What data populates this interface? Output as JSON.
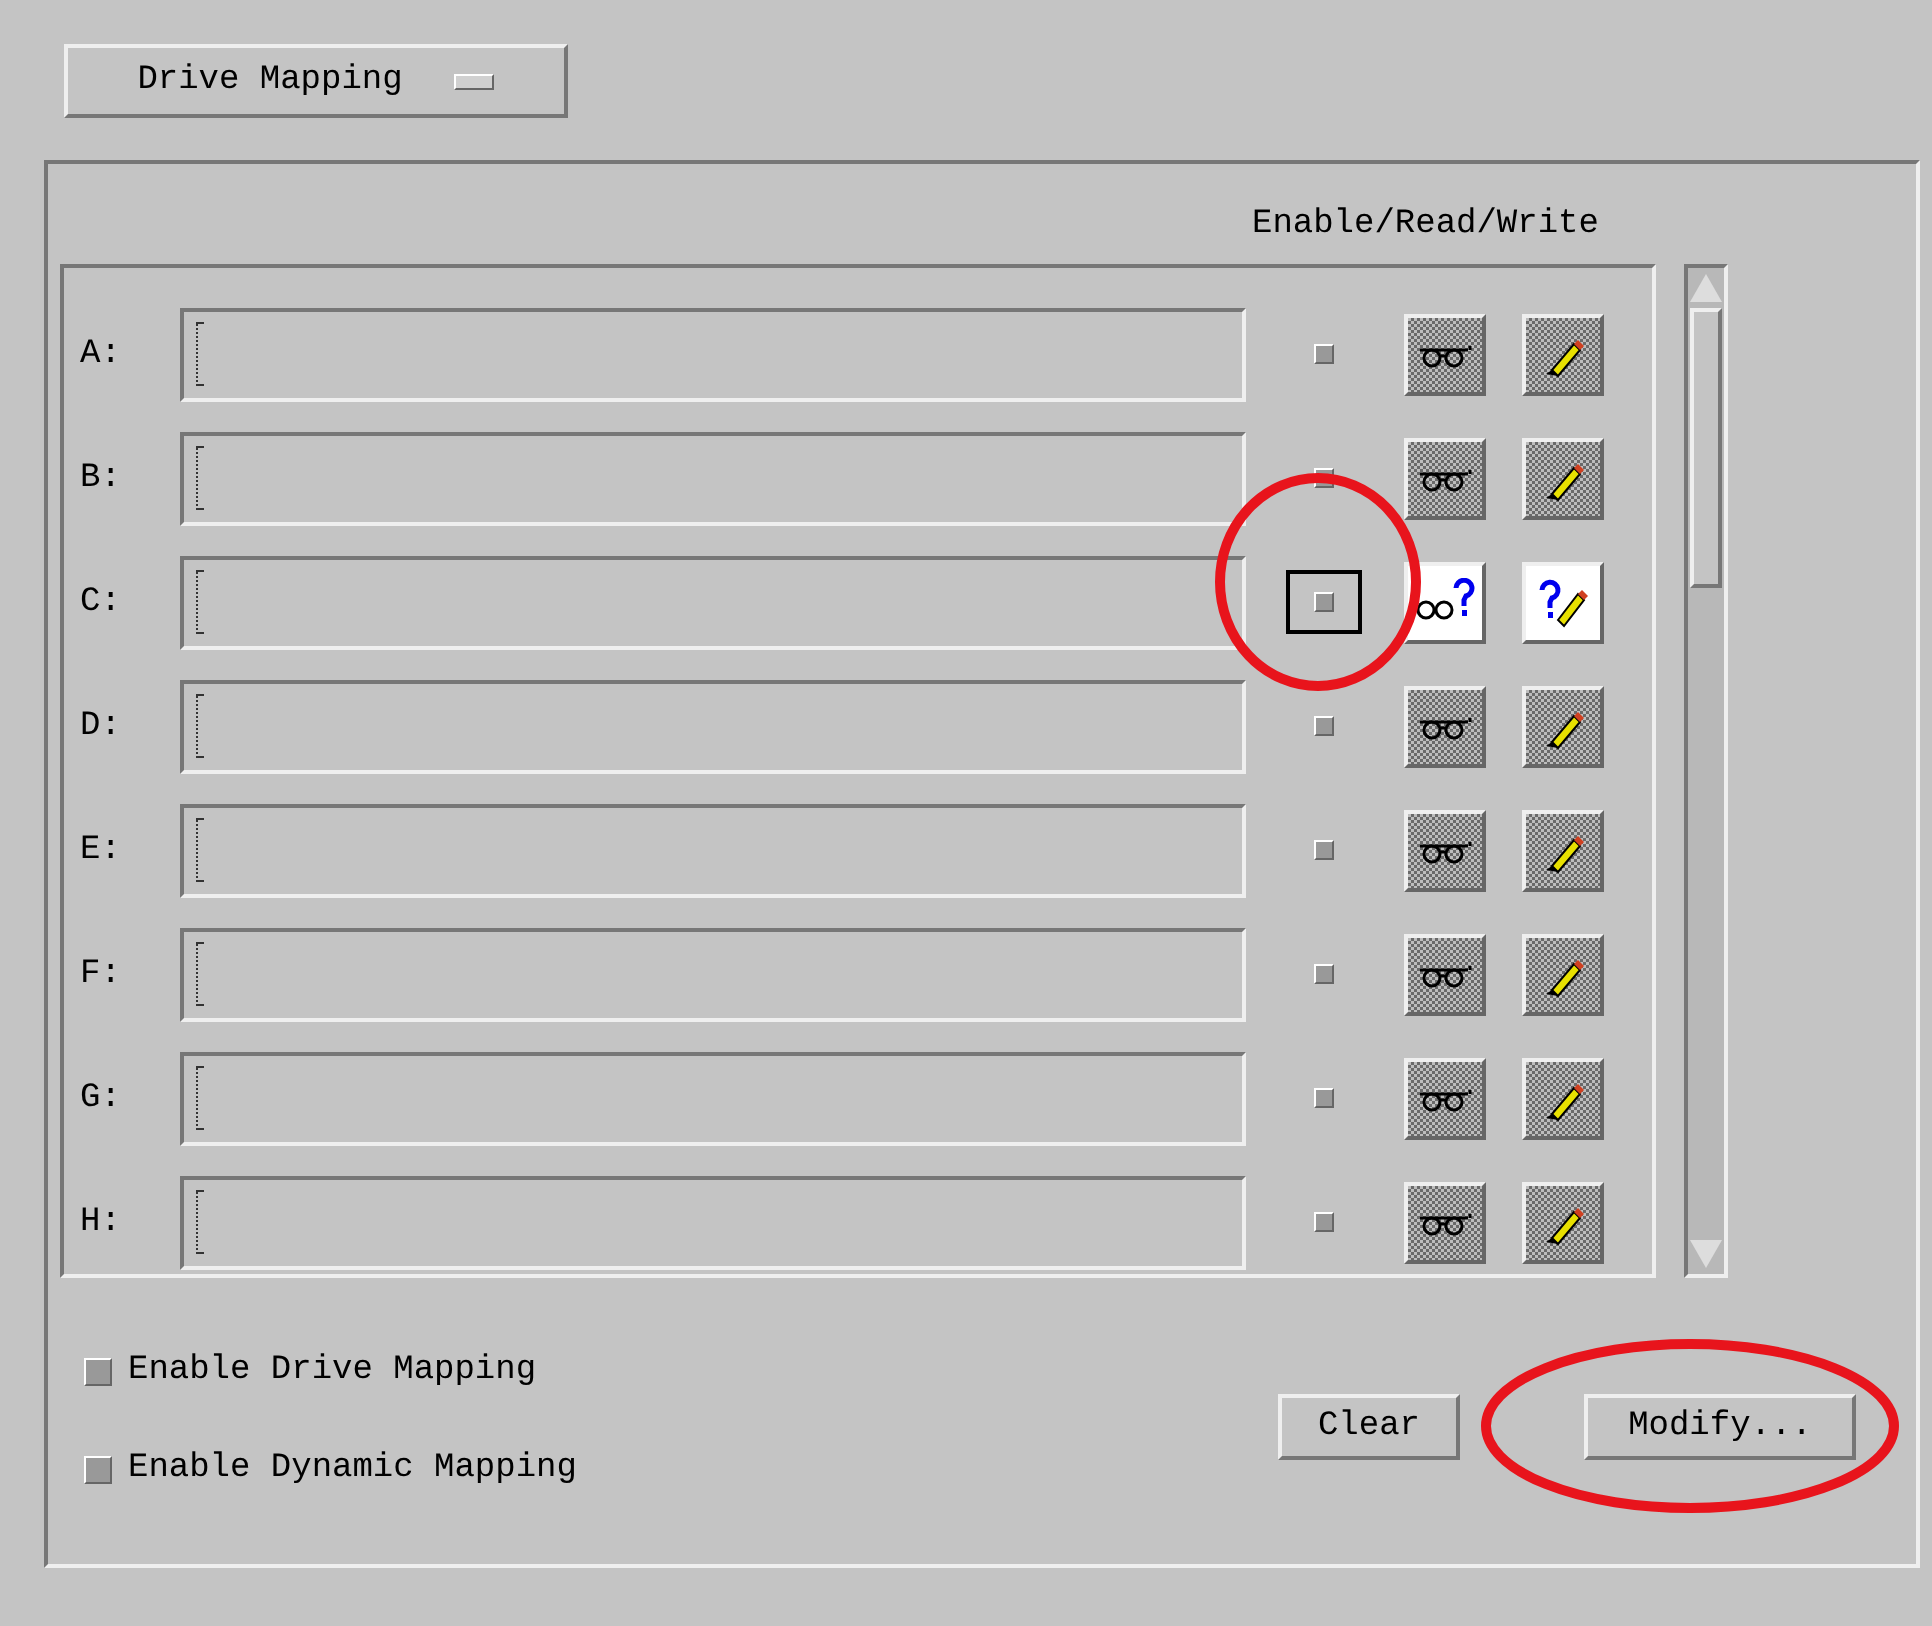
{
  "dropdown": {
    "label": "Drive Mapping"
  },
  "column_heading": "Enable/Read/Write",
  "drives": [
    {
      "label": "A:",
      "enabled": false,
      "focused": false,
      "indeterminate": false
    },
    {
      "label": "B:",
      "enabled": false,
      "focused": false,
      "indeterminate": false
    },
    {
      "label": "C:",
      "enabled": false,
      "focused": true,
      "indeterminate": true
    },
    {
      "label": "D:",
      "enabled": false,
      "focused": false,
      "indeterminate": false
    },
    {
      "label": "E:",
      "enabled": false,
      "focused": false,
      "indeterminate": false
    },
    {
      "label": "F:",
      "enabled": false,
      "focused": false,
      "indeterminate": false
    },
    {
      "label": "G:",
      "enabled": false,
      "focused": false,
      "indeterminate": false
    },
    {
      "label": "H:",
      "enabled": false,
      "focused": false,
      "indeterminate": false
    }
  ],
  "options": [
    {
      "label": "Enable Drive Mapping",
      "checked": false
    },
    {
      "label": "Enable Dynamic Mapping",
      "checked": false
    }
  ],
  "buttons": [
    "Clear",
    "Modify..."
  ]
}
